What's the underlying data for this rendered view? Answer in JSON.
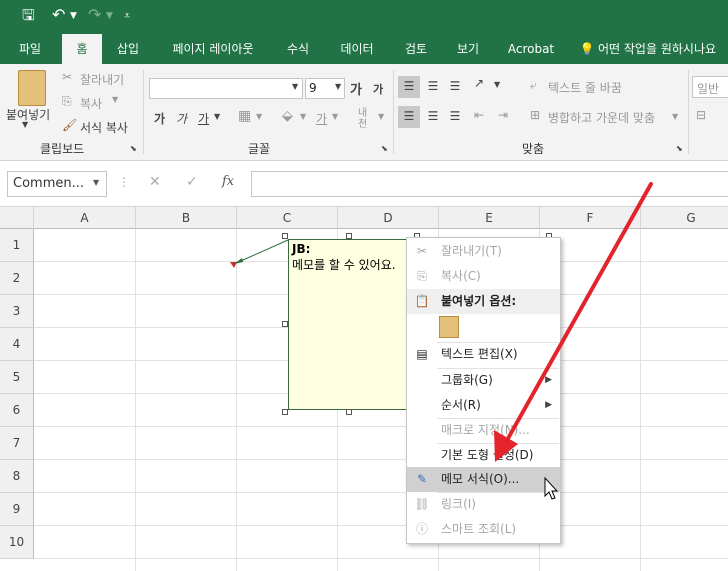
{
  "qat": {
    "save_icon": "save-icon",
    "undo_icon": "undo-icon",
    "redo_icon": "redo-icon",
    "customize_icon": "customize-qat-icon"
  },
  "tabs": [
    {
      "label": "파일"
    },
    {
      "label": "홈"
    },
    {
      "label": "삽입"
    },
    {
      "label": "페이지 레이아웃"
    },
    {
      "label": "수식"
    },
    {
      "label": "데이터"
    },
    {
      "label": "검토"
    },
    {
      "label": "보기"
    },
    {
      "label": "Acrobat"
    },
    {
      "label": "어떤 작업을 원하시나요"
    }
  ],
  "ribbon": {
    "clipboard": {
      "paste": "붙여넣기",
      "cut": "잘라내기",
      "copy": "복사",
      "format_painter": "서식 복사",
      "group": "클립보드"
    },
    "font": {
      "font_name": "",
      "font_size": "9",
      "grow": "가",
      "shrink": "가",
      "bold": "가",
      "italic": "가",
      "underline": "가",
      "font_color": "가",
      "phonetic": "내천",
      "group": "글꼴"
    },
    "alignment": {
      "wrap": "텍스트 줄 바꿈",
      "merge": "병합하고 가운데 맞춤",
      "group": "맞춤"
    },
    "number": {
      "format": "일반"
    }
  },
  "formula_bar": {
    "name_box": "Commen...",
    "cancel": "✕",
    "enter": "✓",
    "fx": "fx",
    "value": ""
  },
  "columns": [
    "A",
    "B",
    "C",
    "D",
    "E",
    "F",
    "G"
  ],
  "rows": [
    "1",
    "2",
    "3",
    "4",
    "5",
    "6",
    "7",
    "8",
    "9",
    "10"
  ],
  "comment": {
    "author": "JB:",
    "text": "메모를 할 수 있어요."
  },
  "context_menu": {
    "items": [
      {
        "label": "잘라내기(T)",
        "icon": "scissors-icon",
        "enabled": false
      },
      {
        "label": "복사(C)",
        "icon": "copy-icon",
        "enabled": false
      },
      {
        "label": "붙여넣기 옵션:",
        "icon": "paste-icon",
        "enabled": true
      },
      {
        "label": "텍스트 편집(X)",
        "icon": "text-edit-icon",
        "enabled": true
      },
      {
        "label": "그룹화(G)",
        "icon": "",
        "enabled": true
      },
      {
        "label": "순서(R)",
        "icon": "",
        "enabled": true
      },
      {
        "label": "매크로 지정(N)...",
        "icon": "",
        "enabled": false
      },
      {
        "label": "기본 도형 설정(D)",
        "icon": "",
        "enabled": true
      },
      {
        "label": "메모 서식(O)...",
        "icon": "format-comment-icon",
        "enabled": true,
        "highlighted": true
      },
      {
        "label": "링크(I)",
        "icon": "link-icon",
        "enabled": false
      },
      {
        "label": "스마트 조회(L)",
        "icon": "smart-lookup-icon",
        "enabled": false
      }
    ]
  },
  "colors": {
    "excel_green": "#217346",
    "arrow_red": "#e3242b",
    "note_bg": "#ffffe1"
  }
}
